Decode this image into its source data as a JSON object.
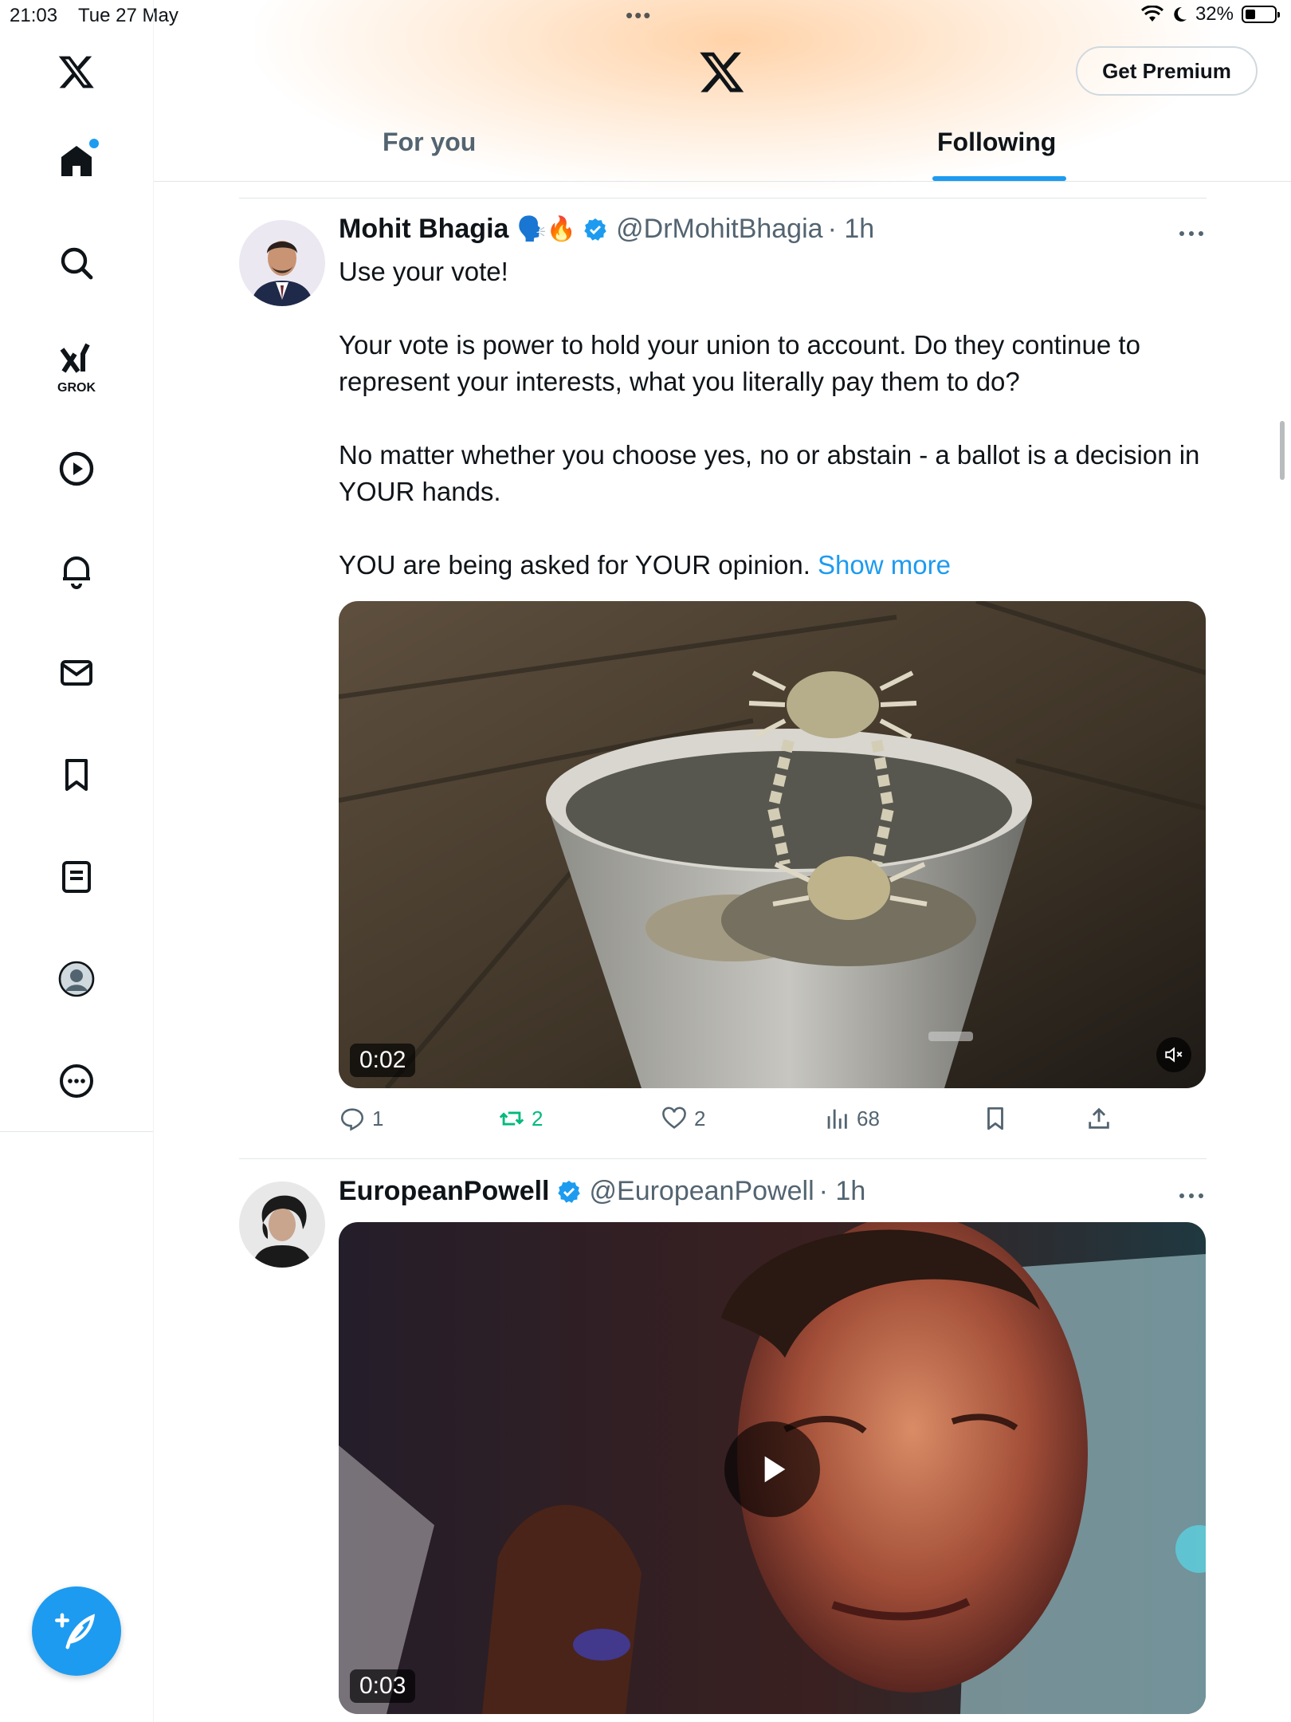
{
  "status_bar": {
    "time": "21:03",
    "date": "Tue 27 May",
    "battery": "32%"
  },
  "sidebar": {
    "items": [
      {
        "name": "home"
      },
      {
        "name": "explore"
      },
      {
        "name": "grok",
        "label": "GROK"
      },
      {
        "name": "videos"
      },
      {
        "name": "notifications"
      },
      {
        "name": "messages"
      },
      {
        "name": "bookmarks"
      },
      {
        "name": "lists"
      },
      {
        "name": "profile"
      },
      {
        "name": "more"
      }
    ],
    "home_has_notification_dot": true
  },
  "header": {
    "premium_label": "Get Premium",
    "tabs": [
      {
        "label": "For you",
        "active": false
      },
      {
        "label": "Following",
        "active": true
      }
    ]
  },
  "tweets": [
    {
      "name": "Mohit Bhagia",
      "emoji": "🗣️🔥",
      "verified": true,
      "handle": "@DrMohitBhagia",
      "time": "· 1h",
      "paragraphs": [
        "Use your vote!",
        "Your vote is power to hold your union to account. Do they continue to represent your interests, what you literally pay them to do?",
        "No matter whether you choose yes, no or abstain - a ballot is a decision in YOUR hands.",
        "YOU are being asked for YOUR opinion."
      ],
      "show_more": "Show more",
      "video_duration": "0:02",
      "stats": {
        "replies": "1",
        "reposts": "2",
        "likes": "2",
        "views": "68"
      }
    },
    {
      "name": "EuropeanPowell",
      "verified": true,
      "handle": "@EuropeanPowell",
      "time": "· 1h",
      "video_duration": "0:03"
    }
  ],
  "colors": {
    "accent": "#1d9bf0",
    "repost_active": "#00ba7c",
    "secondary_text": "#536471"
  }
}
